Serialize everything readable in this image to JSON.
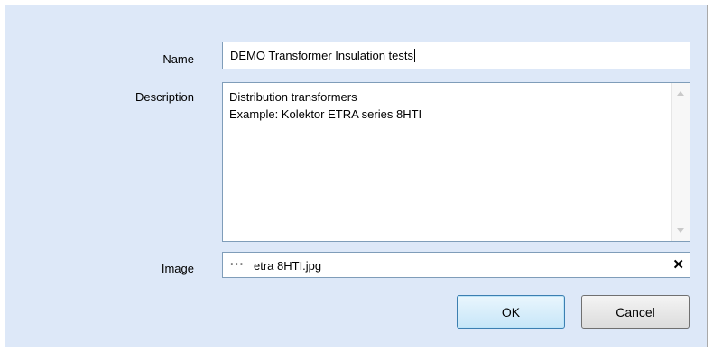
{
  "form": {
    "name_label": "Name",
    "name_value": "DEMO Transformer Insulation tests",
    "description_label": "Description",
    "description_lines": [
      "Distribution transformers",
      "Example: Kolektor ETRA series 8HTI"
    ],
    "image_label": "Image",
    "image_browse_glyph": "···",
    "image_filename": "etra 8HTI.jpg",
    "image_clear_glyph": "✕"
  },
  "buttons": {
    "ok_label": "OK",
    "cancel_label": "Cancel"
  }
}
